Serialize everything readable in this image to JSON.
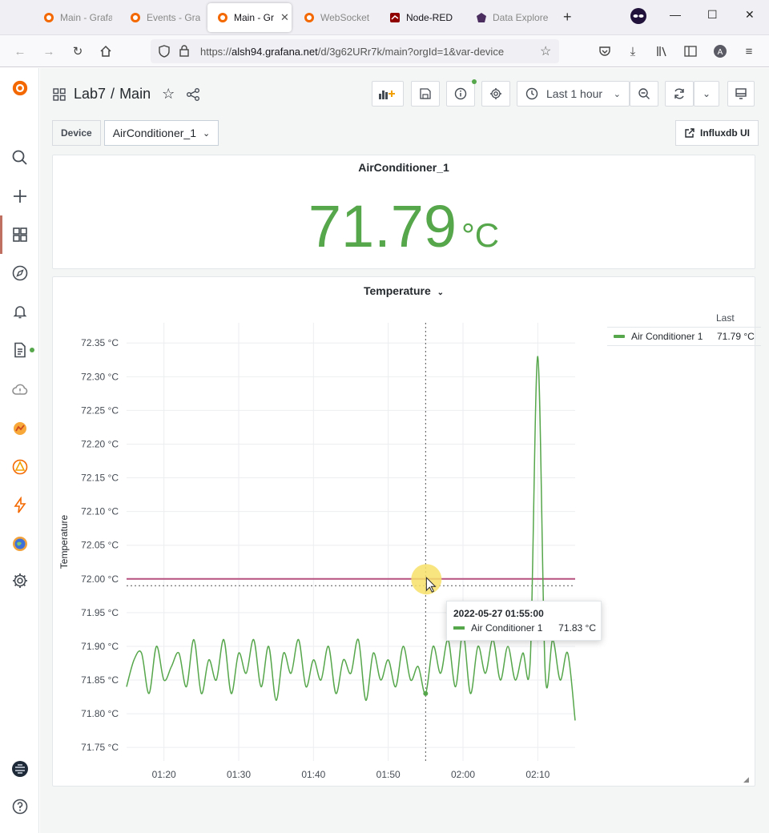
{
  "browser": {
    "tabs": [
      {
        "label": "Main - Grafa",
        "active": false
      },
      {
        "label": "Events - Graf",
        "active": false
      },
      {
        "label": "Main - Gr",
        "active": true
      },
      {
        "label": "WebSocket",
        "active": false
      },
      {
        "label": "Node-RED",
        "active": false
      },
      {
        "label": "Data Explore",
        "active": false
      }
    ],
    "url_prefix": "https://",
    "url_host": "alsh94.grafana.net",
    "url_path": "/d/3g62URr7k/main?orgId=1&var-device"
  },
  "dashboard": {
    "folder": "Lab7",
    "separator": "/",
    "name": "Main",
    "time_range": "Last 1 hour"
  },
  "variables": {
    "label": "Device",
    "value": "AirConditioner_1"
  },
  "link_button": "Influxdb UI",
  "stat_panel": {
    "title": "AirConditioner_1",
    "value": "71.79",
    "unit": "°C",
    "color": "#56a64b"
  },
  "graph_panel": {
    "title": "Temperature",
    "legend_header": "Last",
    "legend": [
      {
        "name": "Air Conditioner 1",
        "value": "71.79 °C",
        "color": "#56a64b"
      }
    ],
    "tooltip": {
      "time": "2022-05-27 01:55:00",
      "series": "Air Conditioner 1",
      "value": "71.83 °C"
    }
  },
  "chart_data": {
    "type": "line",
    "ylabel": "Temperature",
    "xlabel": "",
    "y_ticks": [
      "72.35 °C",
      "72.30 °C",
      "72.25 °C",
      "72.20 °C",
      "72.15 °C",
      "72.10 °C",
      "72.05 °C",
      "72.00 °C",
      "71.95 °C",
      "71.90 °C",
      "71.85 °C",
      "71.80 °C",
      "71.75 °C"
    ],
    "x_ticks": [
      "01:20",
      "01:30",
      "01:40",
      "01:50",
      "02:00",
      "02:10"
    ],
    "ylim": [
      71.73,
      72.38
    ],
    "x_range_minutes": [
      75,
      135
    ],
    "threshold": {
      "value": 72.0,
      "color": "#b6517f"
    },
    "hover_y": 71.99,
    "hover_x_minutes": 115,
    "series": [
      {
        "name": "Air Conditioner 1",
        "color": "#56a64b",
        "x_minutes": [
          75.0,
          76.0,
          77.0,
          78.0,
          79.0,
          80.0,
          81.0,
          82.0,
          83.0,
          84.0,
          85.0,
          86.0,
          87.0,
          88.0,
          89.0,
          90.0,
          91.0,
          92.0,
          93.0,
          94.0,
          95.0,
          96.0,
          97.0,
          98.0,
          99.0,
          100.0,
          101.0,
          102.0,
          103.0,
          104.0,
          105.0,
          106.0,
          107.0,
          108.0,
          109.0,
          110.0,
          111.0,
          112.0,
          113.0,
          114.0,
          115.0,
          116.0,
          117.0,
          118.0,
          119.0,
          120.0,
          121.0,
          122.0,
          123.0,
          124.0,
          125.0,
          126.0,
          127.0,
          128.0,
          129.0,
          130.0,
          131.0,
          132.0,
          133.0,
          134.0,
          135.0
        ],
        "values": [
          71.84,
          71.88,
          71.89,
          71.83,
          71.9,
          71.85,
          71.87,
          71.89,
          71.84,
          71.91,
          71.83,
          71.88,
          71.85,
          71.91,
          71.83,
          71.89,
          71.86,
          71.91,
          71.84,
          71.9,
          71.82,
          71.89,
          71.86,
          71.91,
          71.84,
          71.88,
          71.85,
          71.9,
          71.83,
          71.88,
          71.86,
          71.91,
          71.82,
          71.89,
          71.85,
          71.88,
          71.84,
          71.9,
          71.85,
          71.87,
          71.83,
          71.9,
          71.86,
          71.91,
          71.84,
          71.92,
          71.83,
          71.9,
          71.86,
          71.91,
          71.85,
          71.9,
          71.85,
          71.89,
          71.88,
          72.33,
          71.86,
          71.91,
          71.85,
          71.89,
          71.79
        ]
      }
    ]
  }
}
